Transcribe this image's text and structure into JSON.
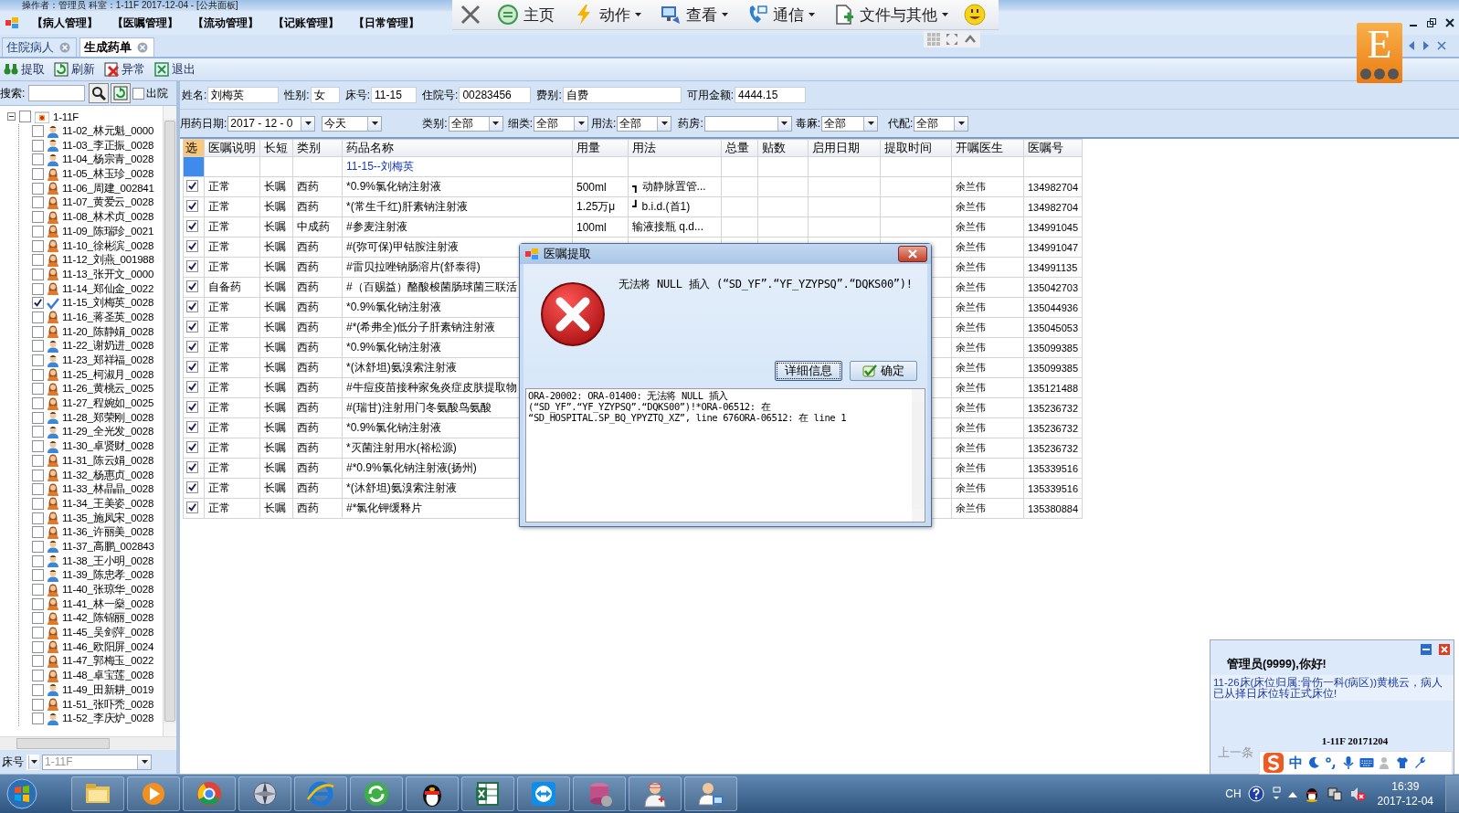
{
  "window": {
    "title": "操作者：管理员 科室：1-11F 2017-12-04 - [公共面板]"
  },
  "menu": [
    "【病人管理】",
    "【医嘱管理】",
    "【流动管理】",
    "【记账管理】",
    "【日常管理】"
  ],
  "quick_toolbar": [
    {
      "kind": "close"
    },
    {
      "kind": "home",
      "label": "主页"
    },
    {
      "kind": "action",
      "label": "动作",
      "dropdown": true
    },
    {
      "kind": "view",
      "label": "查看",
      "dropdown": true
    },
    {
      "kind": "phone",
      "label": "通信",
      "dropdown": true
    },
    {
      "kind": "file",
      "label": "文件与其他",
      "dropdown": true
    },
    {
      "kind": "smiley"
    }
  ],
  "logo": {
    "text": "E"
  },
  "tabs": [
    {
      "label": "住院病人",
      "selected": false
    },
    {
      "label": "生成药单",
      "selected": true
    }
  ],
  "toolbar": [
    {
      "kind": "extract",
      "label": "提取"
    },
    {
      "kind": "refresh",
      "label": "刷新"
    },
    {
      "kind": "error",
      "label": "异常"
    },
    {
      "kind": "exit",
      "label": "退出"
    }
  ],
  "search": {
    "label": "搜索:",
    "discharged_label": "出院",
    "discharged_checked": false
  },
  "tree": {
    "label": "1-11F",
    "expanded": true,
    "checked": false,
    "children": [
      {
        "label": "11-02_林元魁_0000",
        "kind": "male",
        "checked": false
      },
      {
        "label": "11-03_李正振_0028",
        "kind": "male",
        "checked": false
      },
      {
        "label": "11-04_杨宗青_0028",
        "kind": "male",
        "checked": false
      },
      {
        "label": "11-05_林玉珍_0028",
        "kind": "female",
        "checked": false
      },
      {
        "label": "11-06_周建_002841",
        "kind": "female",
        "checked": false
      },
      {
        "label": "11-07_黄爱云_0028",
        "kind": "female",
        "checked": false
      },
      {
        "label": "11-08_林术贞_0028",
        "kind": "female",
        "checked": false
      },
      {
        "label": "11-09_陈瑞珍_0021",
        "kind": "female",
        "checked": false
      },
      {
        "label": "11-10_徐彬滨_0028",
        "kind": "female",
        "checked": false
      },
      {
        "label": "11-12_刘燕_001988",
        "kind": "female",
        "checked": false
      },
      {
        "label": "11-13_张开文_0000",
        "kind": "female",
        "checked": false
      },
      {
        "label": "11-14_郑仙金_0022",
        "kind": "female",
        "checked": false
      },
      {
        "label": "11-15_刘梅英_0028",
        "kind": "female",
        "checked": true
      },
      {
        "label": "11-16_蒋圣英_0028",
        "kind": "female",
        "checked": false
      },
      {
        "label": "11-20_陈静娟_0028",
        "kind": "female",
        "checked": false
      },
      {
        "label": "11-22_谢奶进_0028",
        "kind": "male",
        "checked": false
      },
      {
        "label": "11-23_郑祥福_0028",
        "kind": "male",
        "checked": false
      },
      {
        "label": "11-25_柯淑月_0028",
        "kind": "female",
        "checked": false
      },
      {
        "label": "11-26_黄桃云_0025",
        "kind": "female",
        "checked": false
      },
      {
        "label": "11-27_程婉如_0025",
        "kind": "female",
        "checked": false
      },
      {
        "label": "11-28_郑荣刚_0028",
        "kind": "male",
        "checked": false
      },
      {
        "label": "11-29_全光发_0028",
        "kind": "male",
        "checked": false
      },
      {
        "label": "11-30_卓贤财_0028",
        "kind": "male",
        "checked": false
      },
      {
        "label": "11-31_陈云娟_0028",
        "kind": "female",
        "checked": false
      },
      {
        "label": "11-32_杨惠贞_0028",
        "kind": "female",
        "checked": false
      },
      {
        "label": "11-33_林晶晶_0028",
        "kind": "female",
        "checked": false
      },
      {
        "label": "11-34_王美姿_0028",
        "kind": "female",
        "checked": false
      },
      {
        "label": "11-35_施凤宋_0028",
        "kind": "female",
        "checked": false
      },
      {
        "label": "11-36_许丽美_0028",
        "kind": "female",
        "checked": false
      },
      {
        "label": "11-37_高鹏_002843",
        "kind": "male",
        "checked": false
      },
      {
        "label": "11-38_王小明_0028",
        "kind": "male",
        "checked": false
      },
      {
        "label": "11-39_陈忠孝_0028",
        "kind": "male",
        "checked": false
      },
      {
        "label": "11-40_张琼华_0028",
        "kind": "female",
        "checked": false
      },
      {
        "label": "11-41_林一燊_0028",
        "kind": "female",
        "checked": false
      },
      {
        "label": "11-42_陈锦丽_0028",
        "kind": "female",
        "checked": false
      },
      {
        "label": "11-45_吴剑萍_0028",
        "kind": "female",
        "checked": false
      },
      {
        "label": "11-46_欧阳屏_0024",
        "kind": "female",
        "checked": false
      },
      {
        "label": "11-47_郭梅玉_0022",
        "kind": "female",
        "checked": false
      },
      {
        "label": "11-48_卓宝莲_0028",
        "kind": "female",
        "checked": false
      },
      {
        "label": "11-49_田新耕_0019",
        "kind": "male",
        "checked": false
      },
      {
        "label": "11-51_张吓秃_0028",
        "kind": "female",
        "checked": false
      },
      {
        "label": "11-52_李庆炉_0028",
        "kind": "male",
        "checked": false
      }
    ]
  },
  "bed_filter": {
    "label": "床号",
    "value": "1-11F"
  },
  "patient": [
    {
      "label": "姓名:",
      "value": "刘梅英"
    },
    {
      "label": "性别:",
      "value": "女"
    },
    {
      "label": "床号:",
      "value": "11-15"
    },
    {
      "label": "住院号:",
      "value": "00283456"
    },
    {
      "label": "费别:",
      "value": "自费"
    },
    {
      "label": "可用金额:",
      "value": "4444.15"
    }
  ],
  "filters": [
    {
      "label": "用药日期:",
      "value": "2017 - 12 - 0"
    },
    {
      "value": "今天"
    },
    {
      "label": "类别:",
      "value": "全部"
    },
    {
      "label": "细类:",
      "value": "全部"
    },
    {
      "label": "用法:",
      "value": "全部"
    },
    {
      "label": "药房:"
    },
    {
      "label": "毒麻:",
      "value": "全部"
    },
    {
      "label": "代配:",
      "value": "全部"
    }
  ],
  "table": {
    "columns": [
      "选",
      "医嘱说明",
      "长短",
      "类别",
      "药品名称",
      "用量",
      "用法",
      "总量",
      "贴数",
      "启用日期",
      "提取时间",
      "开嘱医生",
      "医嘱号"
    ],
    "group": {
      "label": "11-15--刘梅英",
      "selected": true
    },
    "rows": [
      {
        "checked": true,
        "note": "正常",
        "term": "长嘱",
        "category": "西药",
        "drug": "*0.9%氯化钠注射液",
        "dose": "500ml",
        "usage": "┓ 动静脉置管...",
        "doctor": "余兰伟",
        "order_no": "134982704"
      },
      {
        "checked": true,
        "note": "正常",
        "term": "长嘱",
        "category": "西药",
        "drug": "*(常生千红)肝素钠注射液",
        "dose": "1.25万μ",
        "usage": "┛ b.i.d.(首1)",
        "doctor": "余兰伟",
        "order_no": "134982704"
      },
      {
        "checked": true,
        "note": "正常",
        "term": "长嘱",
        "category": "中成药",
        "drug": "#参麦注射液",
        "dose": "100ml",
        "usage": "输液接瓶 q.d...",
        "doctor": "余兰伟",
        "order_no": "134991045"
      },
      {
        "checked": true,
        "note": "正常",
        "term": "长嘱",
        "category": "西药",
        "drug": "#(弥可保)甲钴胺注射液",
        "doctor": "余兰伟",
        "order_no": "134991047"
      },
      {
        "checked": true,
        "note": "正常",
        "term": "长嘱",
        "category": "西药",
        "drug": "#雷贝拉唑钠肠溶片(舒泰得)",
        "doctor": "余兰伟",
        "order_no": "134991135"
      },
      {
        "checked": true,
        "note": "自备药",
        "term": "长嘱",
        "category": "西药",
        "drug": "#（百赐益）酪酸梭菌肠球菌三联活",
        "doctor": "余兰伟",
        "order_no": "135042703"
      },
      {
        "checked": true,
        "note": "正常",
        "term": "长嘱",
        "category": "西药",
        "drug": "*0.9%氯化钠注射液",
        "doctor": "余兰伟",
        "order_no": "135044936"
      },
      {
        "checked": true,
        "note": "正常",
        "term": "长嘱",
        "category": "西药",
        "drug": "#*(希弗全)低分子肝素钠注射液",
        "doctor": "余兰伟",
        "order_no": "135045053"
      },
      {
        "checked": true,
        "note": "正常",
        "term": "长嘱",
        "category": "西药",
        "drug": "*0.9%氯化钠注射液",
        "doctor": "余兰伟",
        "order_no": "135099385"
      },
      {
        "checked": true,
        "note": "正常",
        "term": "长嘱",
        "category": "西药",
        "drug": "*(沐舒坦)氨溴索注射液",
        "doctor": "余兰伟",
        "order_no": "135099385"
      },
      {
        "checked": true,
        "note": "正常",
        "term": "长嘱",
        "category": "西药",
        "drug": "#牛痘疫苗接种家兔炎症皮肤提取物",
        "doctor": "余兰伟",
        "order_no": "135121488"
      },
      {
        "checked": true,
        "note": "正常",
        "term": "长嘱",
        "category": "西药",
        "drug": "#(瑞甘)注射用门冬氨酸鸟氨酸",
        "doctor": "余兰伟",
        "order_no": "135236732"
      },
      {
        "checked": true,
        "note": "正常",
        "term": "长嘱",
        "category": "西药",
        "drug": "*0.9%氯化钠注射液",
        "doctor": "余兰伟",
        "order_no": "135236732"
      },
      {
        "checked": true,
        "note": "正常",
        "term": "长嘱",
        "category": "西药",
        "drug": "*灭菌注射用水(裕松源)",
        "doctor": "余兰伟",
        "order_no": "135236732"
      },
      {
        "checked": true,
        "note": "正常",
        "term": "长嘱",
        "category": "西药",
        "drug": "#*0.9%氯化钠注射液(扬州)",
        "doctor": "余兰伟",
        "order_no": "135339516"
      },
      {
        "checked": true,
        "note": "正常",
        "term": "长嘱",
        "category": "西药",
        "drug": "*(沐舒坦)氨溴索注射液",
        "doctor": "余兰伟",
        "order_no": "135339516"
      },
      {
        "checked": true,
        "note": "正常",
        "term": "长嘱",
        "category": "西药",
        "drug": "#*氯化钾缓释片",
        "doctor": "余兰伟",
        "order_no": "135380884"
      }
    ]
  },
  "dialog": {
    "title": "医嘱提取",
    "message": "无法将 NULL 插入 (“SD_YF”.“YF_YZYPSQ”.“DQKS00”)!",
    "buttons": [
      {
        "label": "详细信息",
        "kind": "details",
        "focused": true
      },
      {
        "label": "确定",
        "kind": "ok",
        "focused": false
      }
    ],
    "details": "ORA-20002: ORA-01400: 无法将 NULL 插入\n(“SD_YF”.“YF_YZYPSQ”.“DQKS00”)!*ORA-06512: 在\n“SD_HOSPITAL.SP_BQ_YPYZTQ_XZ”, line 676ORA-06512: 在 line 1"
  },
  "notification": {
    "greeting": "管理员(9999),你好!",
    "message": "11-26床(床位归属:骨伤一科(病区))黄桃云，病人已从择日床位转正式床位!",
    "footer": "1-11F 20171204",
    "previous": "上一条"
  },
  "ime": {
    "mode": "中"
  },
  "taskbar": {
    "apps": [
      {
        "kind": "folder"
      },
      {
        "kind": "player"
      },
      {
        "kind": "chrome"
      },
      {
        "kind": "compass"
      },
      {
        "kind": "ie"
      },
      {
        "kind": "green"
      },
      {
        "kind": "penguin"
      },
      {
        "kind": "excel"
      },
      {
        "kind": "remote"
      },
      {
        "kind": "database"
      },
      {
        "kind": "nurse"
      },
      {
        "kind": "doctor"
      }
    ],
    "language": "CH",
    "time": "16:39",
    "date": "2017-12-04"
  }
}
